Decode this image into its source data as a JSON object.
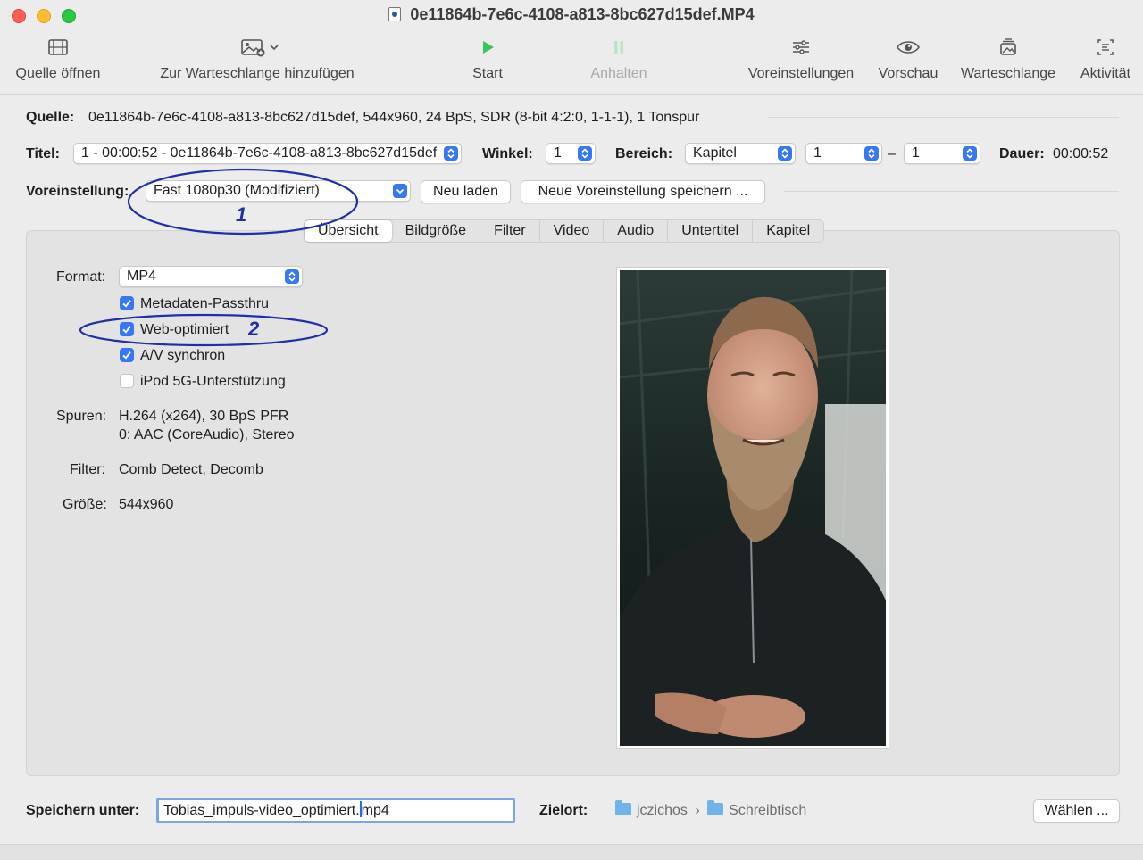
{
  "window": {
    "title": "0e11864b-7e6c-4108-a813-8bc627d15def.MP4"
  },
  "toolbar": {
    "open_source": "Quelle öffnen",
    "add_to_queue": "Zur Warteschlange hinzufügen",
    "start": "Start",
    "pause": "Anhalten",
    "presets": "Voreinstellungen",
    "preview": "Vorschau",
    "queue": "Warteschlange",
    "activity": "Aktivität"
  },
  "source": {
    "label": "Quelle:",
    "value": "0e11864b-7e6c-4108-a813-8bc627d15def, 544x960, 24 BpS, SDR (8-bit 4:2:0, 1-1-1), 1 Tonspur"
  },
  "title_row": {
    "title_label": "Titel:",
    "title_value": "1 - 00:00:52 - 0e11864b-7e6c-4108-a813-8bc627d15def",
    "angle_label": "Winkel:",
    "angle_value": "1",
    "range_label": "Bereich:",
    "range_type": "Kapitel",
    "range_from": "1",
    "range_sep": "–",
    "range_to": "1",
    "duration_label": "Dauer:",
    "duration_value": "00:00:52"
  },
  "preset_row": {
    "label": "Voreinstellung:",
    "value": "Fast 1080p30 (Modifiziert)",
    "reload": "Neu laden",
    "save_new": "Neue Voreinstellung speichern ..."
  },
  "annotations": {
    "marker1": "1",
    "marker2": "2",
    "color": "#1f2fa8"
  },
  "tabs": [
    "Übersicht",
    "Bildgröße",
    "Filter",
    "Video",
    "Audio",
    "Untertitel",
    "Kapitel"
  ],
  "summary": {
    "format_label": "Format:",
    "format_value": "MP4",
    "options": [
      {
        "label": "Metadaten-Passthru",
        "checked": true
      },
      {
        "label": "Web-optimiert",
        "checked": true
      },
      {
        "label": "A/V synchron",
        "checked": true
      },
      {
        "label": "iPod 5G-Unterstützung",
        "checked": false
      }
    ],
    "tracks_label": "Spuren:",
    "tracks_line1": "H.264 (x264), 30 BpS PFR",
    "tracks_line2": "0: AAC (CoreAudio), Stereo",
    "filters_label": "Filter:",
    "filters_value": "Comb Detect, Decomb",
    "size_label": "Größe:",
    "size_value": "544x960"
  },
  "save": {
    "label": "Speichern unter:",
    "filename_before_caret": "Tobias_impuls-video_optimiert.",
    "filename_after_caret": "mp4",
    "dest_label": "Zielort:",
    "path_user": "jczichos",
    "path_sep": "›",
    "path_folder": "Schreibtisch",
    "choose": "Wählen ..."
  },
  "colors": {
    "accent": "#3478f6",
    "start_green": "#34c759"
  }
}
